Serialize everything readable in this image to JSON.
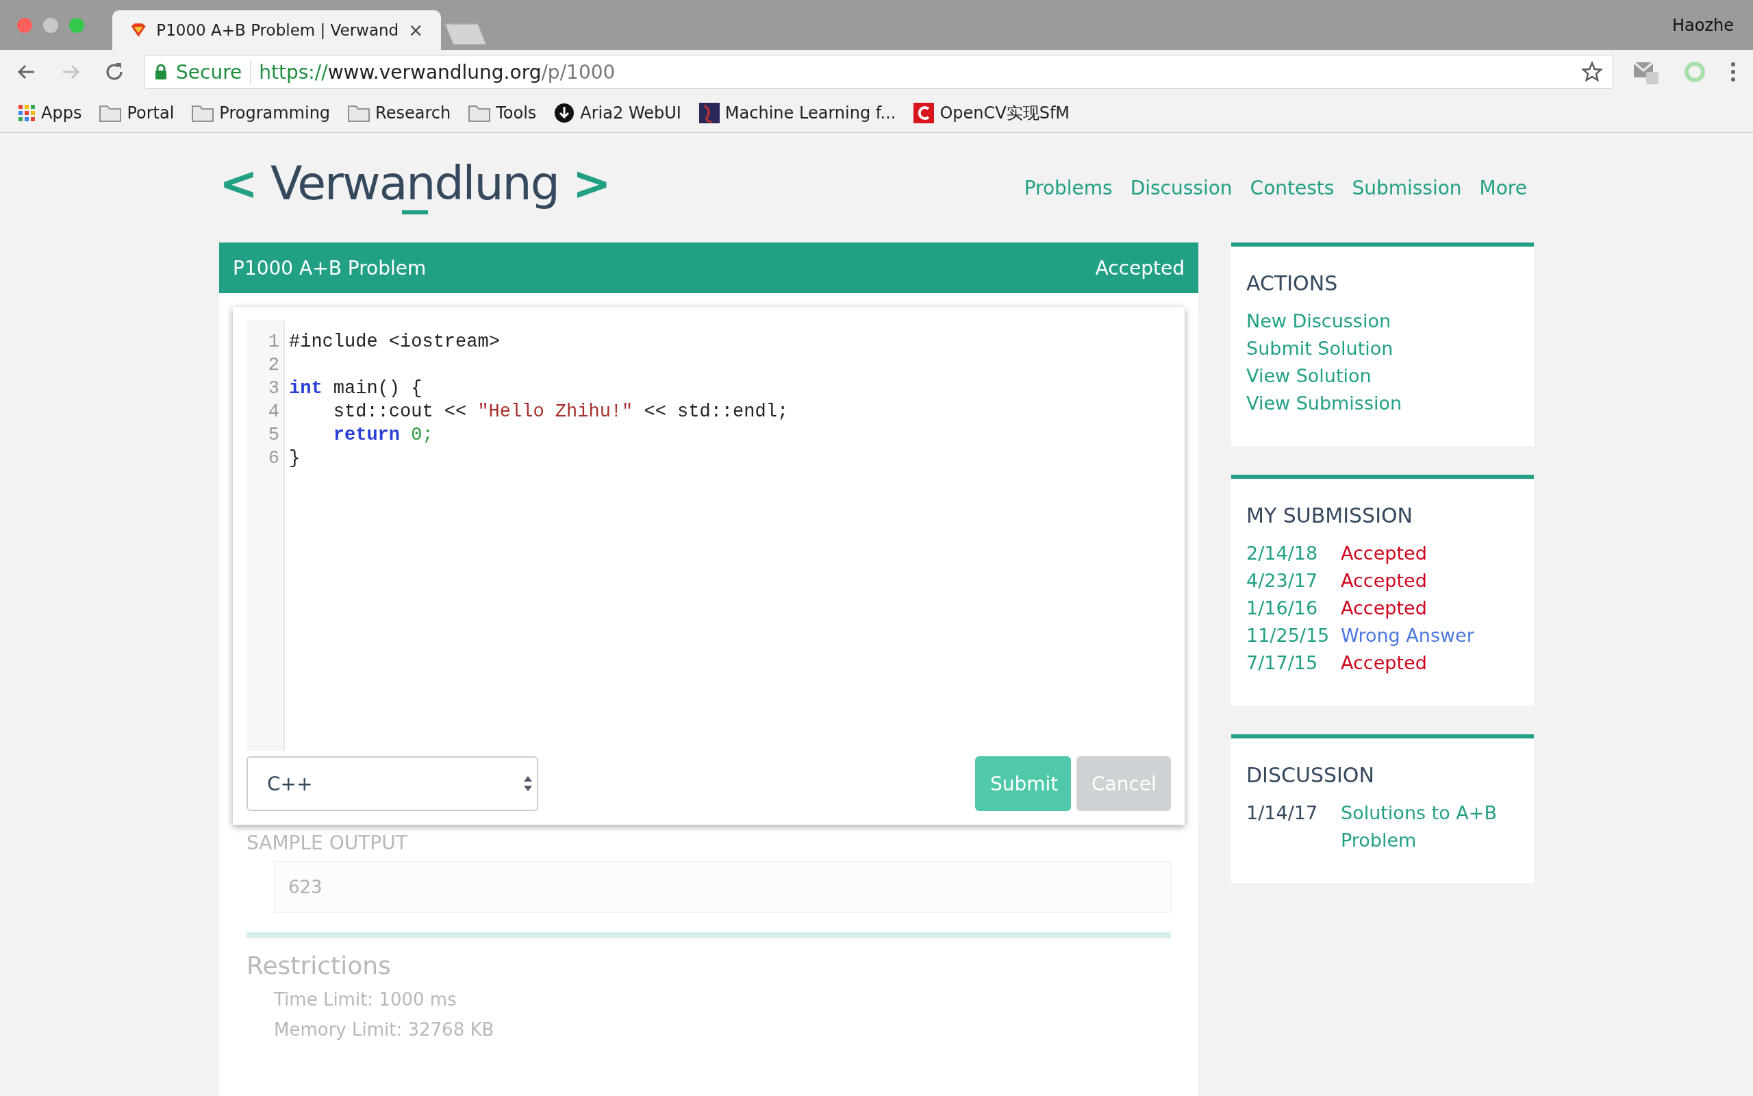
{
  "browser": {
    "tab": {
      "title": "P1000 A+B Problem | Verwand",
      "close": "×"
    },
    "profile": "Haozhe",
    "address": {
      "security": "Secure",
      "scheme": "https://",
      "host": "www.verwandlung.org",
      "path": "/p/1000"
    },
    "bookmarks": [
      {
        "kind": "apps",
        "label": "Apps"
      },
      {
        "kind": "folder",
        "label": "Portal"
      },
      {
        "kind": "folder",
        "label": "Programming"
      },
      {
        "kind": "folder",
        "label": "Research"
      },
      {
        "kind": "folder",
        "label": "Tools"
      },
      {
        "kind": "download",
        "label": "Aria2 WebUI"
      },
      {
        "kind": "thumb",
        "label": "Machine Learning f..."
      },
      {
        "kind": "brand",
        "label": "OpenCV实现SfM"
      }
    ]
  },
  "site": {
    "logo": {
      "left": "<",
      "name": "Verwandlung",
      "right": ">"
    },
    "nav": [
      "Problems",
      "Discussion",
      "Contests",
      "Submission",
      "More"
    ]
  },
  "problem": {
    "title": "P1000 A+B Problem",
    "status": "Accepted",
    "body": [
      {
        "kind": "subheading",
        "text": "SAMPLE OUTPUT"
      },
      {
        "kind": "sample",
        "text": "623"
      },
      {
        "kind": "rule"
      },
      {
        "kind": "heading",
        "text": "Restrictions"
      },
      {
        "kind": "text",
        "text": "Time Limit: 1000 ms"
      },
      {
        "kind": "text",
        "text": "Memory Limit: 32768 KB"
      }
    ]
  },
  "editor": {
    "lines": [
      {
        "number": "1",
        "tokens": [
          {
            "kind": "plain",
            "text": "#include <iostream>"
          }
        ]
      },
      {
        "number": "2"
      },
      {
        "number": "3",
        "tokens": [
          {
            "kind": "keyword",
            "text": "int"
          },
          {
            "kind": "plain",
            "text": "main() {"
          }
        ]
      },
      {
        "number": "4",
        "indented": true,
        "tokens": [
          {
            "kind": "plain",
            "text": "std::cout <<"
          },
          {
            "kind": "string",
            "text": "\"Hello Zhihu!\""
          },
          {
            "kind": "plain",
            "text": "<< std::endl;"
          }
        ]
      },
      {
        "number": "5",
        "indented": true,
        "tokens": [
          {
            "kind": "keyword",
            "text": "return"
          },
          {
            "kind": "number",
            "text": "0;"
          }
        ]
      },
      {
        "number": "6",
        "tokens": [
          {
            "kind": "plain",
            "text": "}"
          }
        ]
      }
    ],
    "language": "C++",
    "buttons": [
      {
        "kind": "primary",
        "label": "Submit"
      },
      {
        "kind": "secondary",
        "label": "Cancel"
      }
    ]
  },
  "sidebar": [
    {
      "kind": "links",
      "title": "ACTIONS",
      "links": [
        "New Discussion",
        "Submit Solution",
        "View Solution",
        "View Submission"
      ]
    },
    {
      "kind": "submissions",
      "title": "MY SUBMISSION",
      "rows": [
        {
          "date": "2/14/18",
          "result": "Accepted",
          "color": "#d0021b"
        },
        {
          "date": "4/23/17",
          "result": "Accepted",
          "color": "#d0021b"
        },
        {
          "date": "1/16/16",
          "result": "Accepted",
          "color": "#d0021b"
        },
        {
          "date": "11/25/15",
          "result": "Wrong Answer",
          "color": "#4a78e0"
        },
        {
          "date": "7/17/15",
          "result": "Accepted",
          "color": "#d0021b"
        }
      ]
    },
    {
      "kind": "discussion",
      "title": "DISCUSSION",
      "rows": [
        {
          "date": "1/14/17",
          "topic": "Solutions to A+B Problem"
        }
      ]
    }
  ]
}
